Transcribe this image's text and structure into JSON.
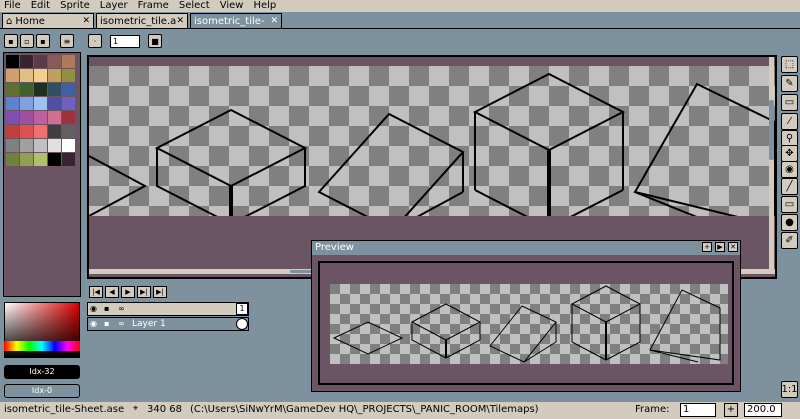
{
  "menu": [
    "File",
    "Edit",
    "Sprite",
    "Layer",
    "Frame",
    "Select",
    "View",
    "Help"
  ],
  "tabs": [
    {
      "label": "Home",
      "close": "✕"
    },
    {
      "label": "isometric_tile.a",
      "close": "✕"
    },
    {
      "label": "isometric_tile-",
      "close": "✕"
    }
  ],
  "toolbar": {
    "brush_size": "1"
  },
  "color_bar": {
    "fg_index": "Idx-32",
    "bg_index": "Idx-0"
  },
  "layers": [
    {
      "name": "",
      "number": "1"
    },
    {
      "name": "Layer 1",
      "number": ""
    }
  ],
  "preview": {
    "title": "Preview"
  },
  "status": {
    "file": "isometric_tile-Sheet.ase",
    "coords": "340 68",
    "path": "(C:\\Users\\SiNwYrM\\GameDev HQ\\_PROJECTS\\_PANIC_ROOM\\Tilemaps)",
    "frame_label": "Frame:",
    "frame_value": "1",
    "zoom": "200.0"
  },
  "colors": {
    "chrome": "#d3cbbe",
    "background": "#7d929e",
    "panel": "#6b5565",
    "checker_light": "#c0c0c0",
    "checker_dark": "#808080"
  }
}
